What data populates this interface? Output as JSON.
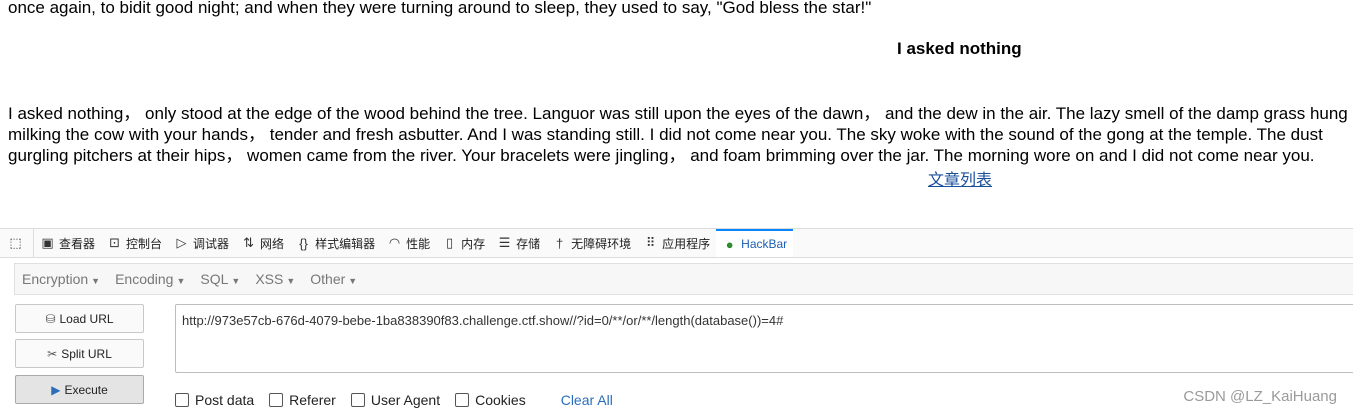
{
  "content": {
    "line_top": "once again, to bidit good night; and when they were turning around to sleep, they used to say, \"God bless the star!\"",
    "heading": "I asked nothing",
    "para_lines": [
      "I asked nothing， only stood at the edge of the wood behind the tree. Languor was still upon the eyes of the dawn， and the dew in the air. The lazy smell of the damp grass hung",
      "milking the cow with your hands， tender and fresh asbutter. And I was standing still. I did not come near you. The sky woke with the sound of the gong at the temple. The dust",
      "gurgling pitchers at their hips， women came from the river. Your bracelets were jingling， and foam brimming over the jar. The morning wore on and I did not come near you."
    ],
    "link": "文章列表"
  },
  "devtools": {
    "tabs": [
      {
        "label": "查看器",
        "icon": "inspector-icon"
      },
      {
        "label": "控制台",
        "icon": "console-icon"
      },
      {
        "label": "调试器",
        "icon": "debugger-icon"
      },
      {
        "label": "网络",
        "icon": "network-icon"
      },
      {
        "label": "样式编辑器",
        "icon": "style-editor-icon"
      },
      {
        "label": "性能",
        "icon": "performance-icon"
      },
      {
        "label": "内存",
        "icon": "memory-icon"
      },
      {
        "label": "存储",
        "icon": "storage-icon"
      },
      {
        "label": "无障碍环境",
        "icon": "accessibility-icon"
      },
      {
        "label": "应用程序",
        "icon": "application-icon"
      },
      {
        "label": "HackBar",
        "icon": "hackbar-icon"
      }
    ],
    "active_tab": "HackBar",
    "accent_color": "#0a84ff"
  },
  "hackbar": {
    "menus": [
      "Encryption",
      "Encoding",
      "SQL",
      "XSS",
      "Other"
    ],
    "buttons": {
      "load": "Load URL",
      "split": "Split URL",
      "execute": "Execute"
    },
    "url": "http://973e57cb-676d-4079-bebe-1ba838390f83.challenge.ctf.show//?id=0/**/or/**/length(database())=4#",
    "options": [
      "Post data",
      "Referer",
      "User Agent",
      "Cookies"
    ],
    "clear_all": "Clear All"
  },
  "watermark": "CSDN @LZ_KaiHuang"
}
